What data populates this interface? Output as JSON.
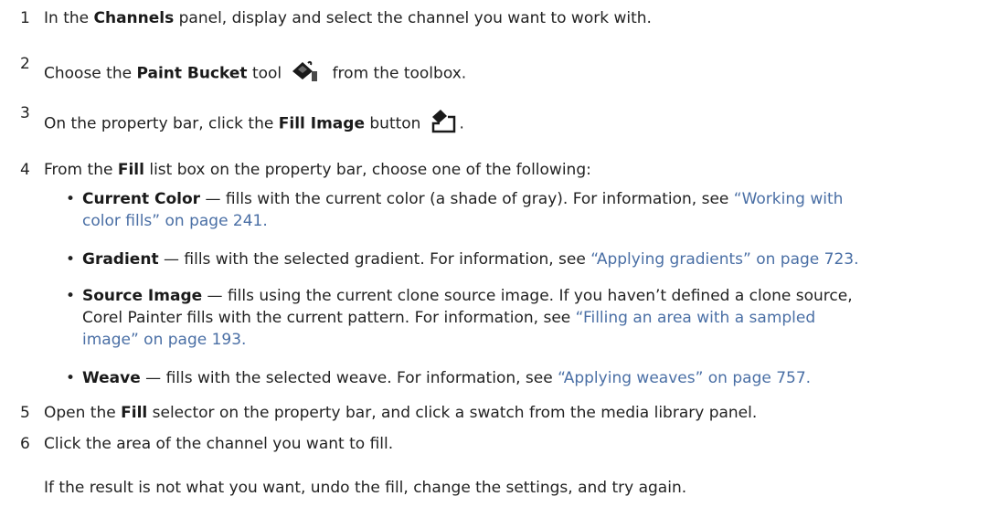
{
  "steps": [
    {
      "number": "1",
      "pre": "In the ",
      "ui": "Channels",
      "post": " panel, display and select the channel you want to work with."
    },
    {
      "number": "2",
      "pre": "Choose the ",
      "ui": "Paint Bucket",
      "mid": " tool",
      "icon": "paint-bucket-icon",
      "post": " from the toolbox."
    },
    {
      "number": "3",
      "pre": "On the property bar, click the ",
      "ui": "Fill Image",
      "mid": " button",
      "icon": "fill-image-icon",
      "post": "."
    },
    {
      "number": "4",
      "pre": "From the ",
      "ui": "Fill",
      "post": " list box on the property bar, choose one of the following:"
    },
    {
      "number": "5",
      "pre": "Open the ",
      "ui": "Fill",
      "post": " selector on the property bar, and click a swatch from the media library panel."
    },
    {
      "number": "6",
      "text": "Click the area of the channel you want to fill."
    }
  ],
  "bullets": [
    {
      "term": "Current Color",
      "line1_text": " — fills with the current color (a shade of gray). For information, see ",
      "line1_link": "“Working with",
      "line2_link": "color fills” on page 241."
    },
    {
      "term": "Gradient",
      "line1_text": " — fills with the selected gradient. For information, see ",
      "line1_link": "“Applying gradients” on page 723."
    },
    {
      "term": "Source Image",
      "line1_text": " — fills using the current clone source image. If you haven’t defined a clone source,",
      "line2_text": "Corel Painter fills with the current pattern. For information, see ",
      "line2_link": "“Filling an area with a sampled",
      "line3_link": "image” on page 193."
    },
    {
      "term": "Weave",
      "line1_text": " — fills with the selected weave. For information, see ",
      "line1_link": "“Applying weaves” on page 757."
    }
  ],
  "bullet_symbol": "•",
  "note": "If the result is not what you want, undo the fill, change the settings, and try again.",
  "colors": {
    "text": "#222222",
    "link": "#4a6fa5"
  }
}
